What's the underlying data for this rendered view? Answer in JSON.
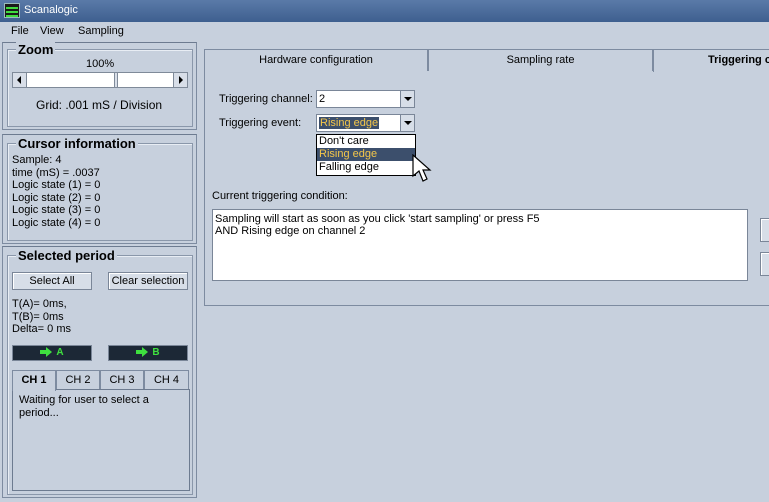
{
  "window": {
    "title": "Scanalogic"
  },
  "menu": {
    "items": [
      "File",
      "View",
      "Sampling"
    ]
  },
  "zoom": {
    "legend": "Zoom",
    "percent": "100%",
    "grid_text": "Grid:  .001 mS / Division",
    "slider_value_fraction": 0.62
  },
  "cursor_info": {
    "legend": "Cursor information",
    "lines": [
      "Sample:  4",
      "time (mS) =  .0037",
      "Logic state (1) =  0",
      "Logic state (2) =  0",
      "Logic state (3) =  0",
      "Logic state (4) =  0"
    ]
  },
  "selected_period": {
    "legend": "Selected period",
    "select_all": "Select All",
    "clear_selection": "Clear selection",
    "ta": "T(A)= 0ms,",
    "tb": "T(B)= 0ms",
    "delta": "Delta= 0 ms",
    "marker_a": "A",
    "marker_b": "B",
    "channel_tabs": [
      "CH 1",
      "CH 2",
      "CH 3",
      "CH 4"
    ],
    "message": "Waiting for user to select a period..."
  },
  "tabs": [
    "Hardware configuration",
    "Sampling rate",
    "Triggering c"
  ],
  "trigger": {
    "channel_label": "Triggering channel:",
    "channel_value": "2",
    "event_label": "Triggering event:",
    "event_value": "Rising edge",
    "event_options": [
      "Don't care",
      "Rising edge",
      "Falling edge"
    ],
    "condition_label": "Current triggering condition:",
    "condition_line1": "Sampling will start as soon as you click 'start sampling' or press F5",
    "condition_line2": "AND Rising edge on channel  2"
  },
  "colors": {
    "background": "#c7d0dd",
    "title_bar": "#4a6a98",
    "selection_bg": "#3c4f6c",
    "selection_text": "#f3c64b",
    "marker_green": "#3fe03f"
  }
}
